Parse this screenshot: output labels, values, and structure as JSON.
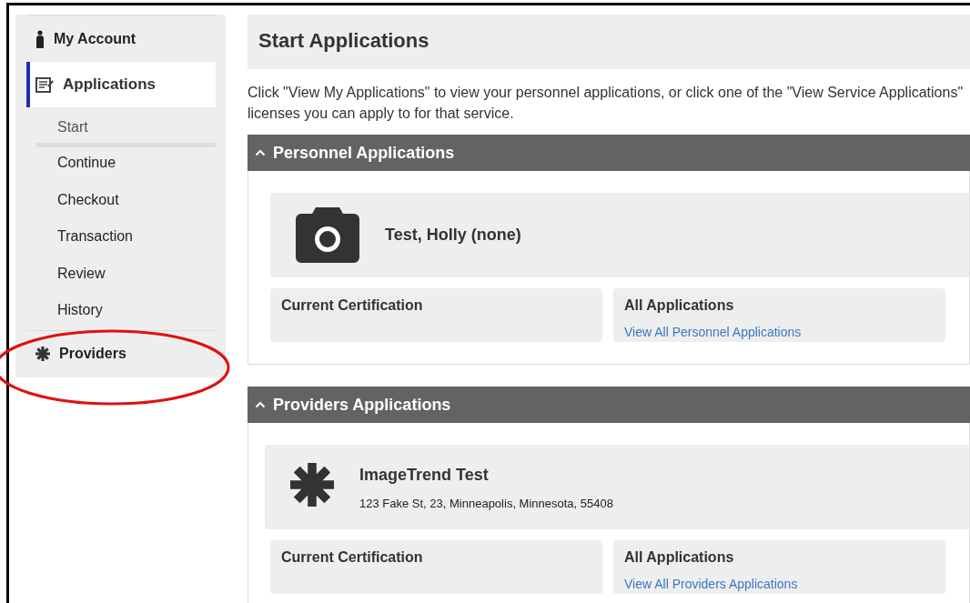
{
  "sidebar": {
    "items": [
      {
        "label": "My Account",
        "selected": false,
        "circled": false
      },
      {
        "label": "Applications",
        "selected": true,
        "circled": false,
        "children": [
          {
            "label": "Start",
            "selected": true
          },
          {
            "label": "Continue",
            "selected": false
          },
          {
            "label": "Checkout",
            "selected": false
          },
          {
            "label": "Transaction",
            "selected": false
          },
          {
            "label": "Review",
            "selected": false
          },
          {
            "label": "History",
            "selected": false
          }
        ]
      },
      {
        "label": "Providers",
        "selected": false,
        "circled": true
      }
    ]
  },
  "page": {
    "title": "Start Applications",
    "intro_lines": [
      "Click \"View My Applications\" to view your personnel applications, or click one of the \"View Service Applications\"",
      "licenses you can apply to for that service."
    ]
  },
  "panels": [
    {
      "title": "Personnel Applications",
      "expanded": true,
      "entity": {
        "name": "Test, Holly (none)"
      },
      "boxes": [
        {
          "title": "Current Certification"
        },
        {
          "title": "All Applications",
          "link": "View All Personnel Applications"
        }
      ]
    },
    {
      "title": "Providers Applications",
      "expanded": true,
      "entity": {
        "name": "ImageTrend Test",
        "address": "123 Fake St, 23, Minneapolis, Minnesota, 55408"
      },
      "boxes": [
        {
          "title": "Current Certification"
        },
        {
          "title": "All Applications",
          "link": "View All Providers Applications"
        }
      ]
    }
  ]
}
